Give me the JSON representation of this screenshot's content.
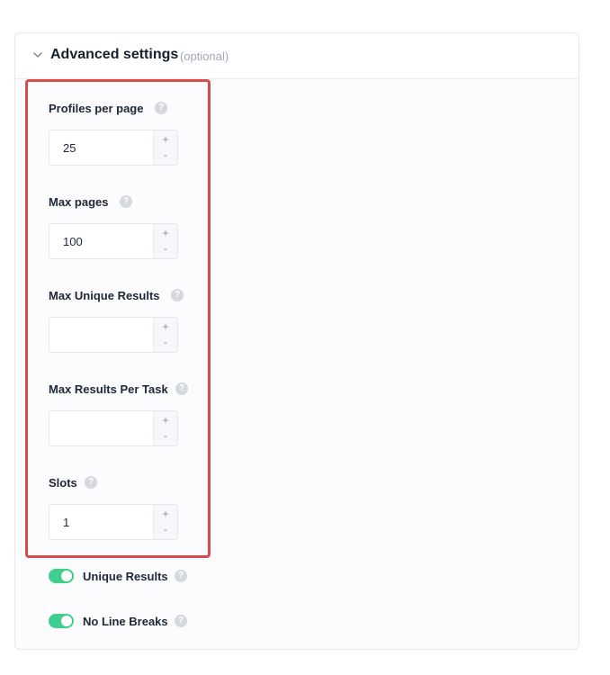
{
  "section": {
    "title": "Advanced settings",
    "optional_note": "(optional)"
  },
  "fields": [
    {
      "label": "Profiles per page",
      "value": "25"
    },
    {
      "label": "Max pages",
      "value": "100"
    },
    {
      "label": "Max Unique Results",
      "value": ""
    },
    {
      "label": "Max Results Per Task",
      "value": ""
    },
    {
      "label": "Slots",
      "value": "1"
    }
  ],
  "stepper": {
    "plus": "+",
    "minus": "-"
  },
  "help_glyph": "?",
  "toggles": [
    {
      "label": "Unique Results",
      "on": true
    },
    {
      "label": "No Line Breaks",
      "on": true
    }
  ],
  "colors": {
    "highlight": "#d94b4b",
    "toggle_on": "#3ecf8e"
  }
}
